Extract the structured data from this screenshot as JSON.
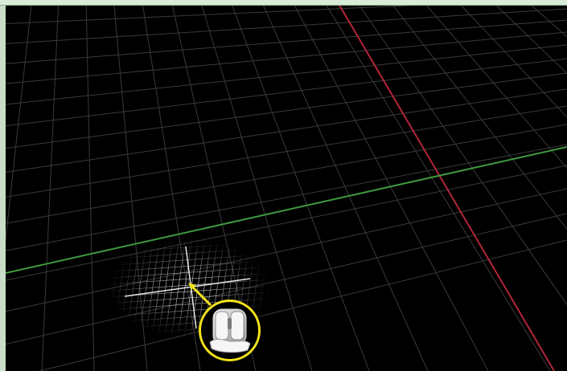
{
  "viewport": {
    "background": "#000000",
    "grid_color": "#6a6a6a",
    "x_axis_color": "#b3253a",
    "y_axis_color": "#3f9a3f",
    "highlight_grid_color": "#ffffff",
    "callout_color": "#f3e21b",
    "icon": "mouse-icon"
  }
}
